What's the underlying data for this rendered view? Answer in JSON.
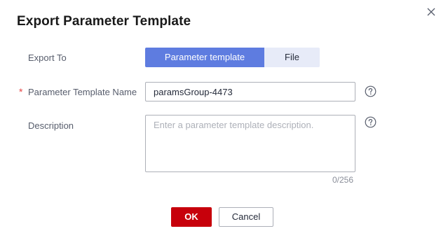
{
  "dialog": {
    "title": "Export Parameter Template"
  },
  "icons": {
    "close": "close-icon",
    "help": "question-circle-icon"
  },
  "colors": {
    "primary_segment": "#5e7ce0",
    "inactive_segment": "#e7ebf8",
    "ok_button": "#c7000b",
    "required_mark": "#e54545"
  },
  "form": {
    "export_to": {
      "label": "Export To",
      "options": [
        "Parameter template",
        "File"
      ],
      "selected": "Parameter template",
      "option_0": "Parameter template",
      "option_1": "File"
    },
    "template_name": {
      "required_mark": "*",
      "label": "Parameter Template Name",
      "value": "paramsGroup-4473"
    },
    "description": {
      "label": "Description",
      "placeholder": "Enter a parameter template description.",
      "value": "",
      "counter": "0/256"
    }
  },
  "actions": {
    "ok": "OK",
    "cancel": "Cancel"
  }
}
